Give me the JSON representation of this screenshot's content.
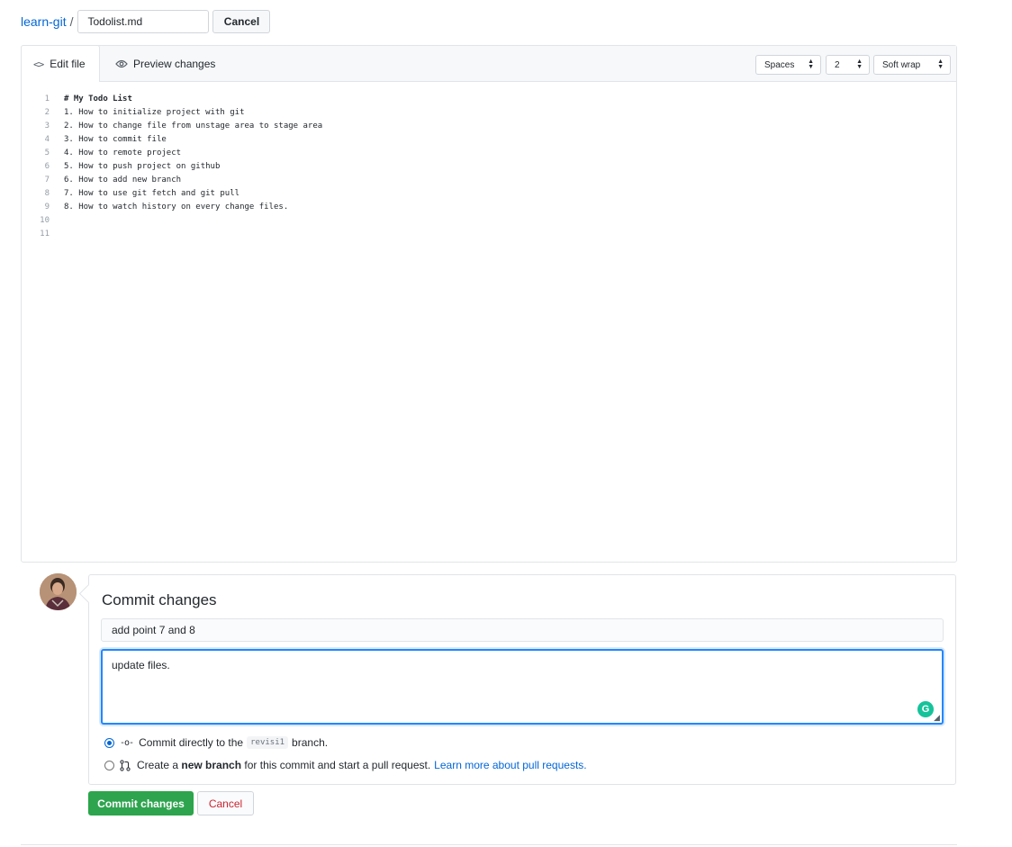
{
  "breadcrumb": {
    "repo": "learn-git",
    "separator": "/",
    "filename": "Todolist.md",
    "cancel_label": "Cancel"
  },
  "editor": {
    "tabs": {
      "edit_label": "Edit file",
      "preview_label": "Preview changes"
    },
    "indent_mode": "Spaces",
    "indent_size": "2",
    "wrap_mode": "Soft wrap",
    "lines": [
      {
        "num": "1",
        "text": "# My Todo List"
      },
      {
        "num": "2",
        "text": "1. How to initialize project with git"
      },
      {
        "num": "3",
        "text": "2. How to change file from unstage area to stage area"
      },
      {
        "num": "4",
        "text": "3. How to commit file"
      },
      {
        "num": "5",
        "text": "4. How to remote project"
      },
      {
        "num": "6",
        "text": "5. How to push project on github"
      },
      {
        "num": "7",
        "text": "6. How to add new branch"
      },
      {
        "num": "8",
        "text": "7. How to use git fetch and git pull"
      },
      {
        "num": "9",
        "text": "8. How to watch history on every change files."
      },
      {
        "num": "10",
        "text": ""
      },
      {
        "num": "11",
        "text": ""
      }
    ]
  },
  "commit": {
    "title": "Commit changes",
    "summary_value": "add point 7 and 8",
    "description_value": "update files.",
    "option_direct": {
      "prefix": "Commit directly to the",
      "branch": "revisi1",
      "suffix": "branch."
    },
    "option_new": {
      "prefix": "Create a",
      "bold": "new branch",
      "suffix": "for this commit and start a pull request.",
      "link": "Learn more about pull requests."
    },
    "commit_label": "Commit changes",
    "cancel_label": "Cancel"
  },
  "colors": {
    "link": "#0366d6",
    "commit_button": "#2ea44f",
    "cancel_text": "#cb2431",
    "focus": "#2188ff"
  },
  "icons": {
    "edit_tab": "code-icon",
    "preview_tab": "eye-icon",
    "direct_commit": "git-commit-icon",
    "new_branch": "git-pull-request-icon",
    "grammarly": "grammarly-icon"
  }
}
